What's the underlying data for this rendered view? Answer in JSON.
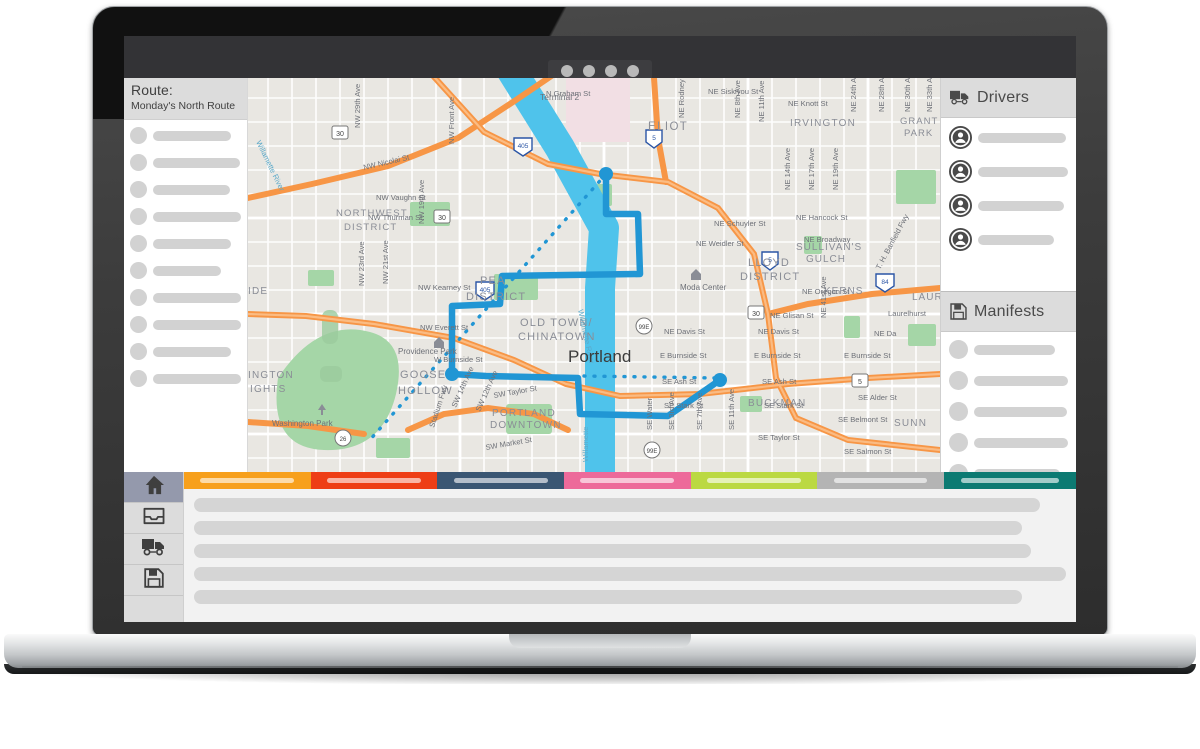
{
  "device": {
    "type": "laptop-mockup",
    "topbar": {
      "dots": 4
    }
  },
  "route_panel": {
    "title": "Route:",
    "subtitle": "Monday's North Route",
    "items": [
      {
        "bar_width_pct": 70
      },
      {
        "bar_width_pct": 78
      },
      {
        "bar_width_pct": 69
      },
      {
        "bar_width_pct": 85
      },
      {
        "bar_width_pct": 70
      },
      {
        "bar_width_pct": 61
      },
      {
        "bar_width_pct": 79
      },
      {
        "bar_width_pct": 86
      },
      {
        "bar_width_pct": 70
      },
      {
        "bar_width_pct": 83
      }
    ]
  },
  "drivers_panel": {
    "title": "Drivers",
    "icon": "truck-icon",
    "items": [
      {
        "bar_width_pct": 74
      },
      {
        "bar_width_pct": 79
      },
      {
        "bar_width_pct": 72
      },
      {
        "bar_width_pct": 64
      }
    ]
  },
  "manifests_panel": {
    "title": "Manifests",
    "icon": "floppy-disk-icon",
    "items": [
      {
        "bar_width_pct": 68
      },
      {
        "bar_width_pct": 86
      },
      {
        "bar_width_pct": 78
      },
      {
        "bar_width_pct": 84
      },
      {
        "bar_width_pct": 72
      }
    ]
  },
  "icon_rail": {
    "buttons": [
      {
        "icon": "home-icon",
        "name": "home",
        "active": true
      },
      {
        "icon": "inbox-tray-icon",
        "name": "inbox",
        "active": false
      },
      {
        "icon": "truck-icon",
        "name": "deliveries",
        "active": false
      },
      {
        "icon": "floppy-disk-icon",
        "name": "save",
        "active": false
      }
    ]
  },
  "tabbar": {
    "tabs": [
      {
        "color": "#F7A01C",
        "width_pct": 14.2
      },
      {
        "color": "#EE3E16",
        "width_pct": 14.2
      },
      {
        "color": "#3A5673",
        "width_pct": 14.2
      },
      {
        "color": "#ED6A9A",
        "width_pct": 14.2
      },
      {
        "color": "#BBD942",
        "width_pct": 14.2
      },
      {
        "color": "#B4B4B4",
        "width_pct": 14.2
      },
      {
        "color": "#0C7A72",
        "width_pct": 14.8
      }
    ]
  },
  "content": {
    "rows": [
      {
        "width_pct": 97
      },
      {
        "width_pct": 95
      },
      {
        "width_pct": 96
      },
      {
        "width_pct": 100
      },
      {
        "width_pct": 95
      }
    ]
  },
  "map": {
    "city_label": "Portland",
    "water_color": "#4FC3EB",
    "route_color": "#2196D4",
    "highway_color": "#F79646",
    "park_color": "#A5D6A7",
    "land_color": "#E9E7E2",
    "neighborhoods": [
      "Terminal 2",
      "ELIOT",
      "IRVINGTON",
      "GRANT PARK",
      "NORTHWEST DISTRICT",
      "LLOYD DISTRICT",
      "SULLIVAN'S GULCH",
      "KERNS",
      "LAURE",
      "PEARL DISTRICT",
      "OLD TOWN/ CHINATOWN",
      "GOOSE HOLLOW",
      "PORTLAND DOWNTOWN",
      "BUCKMAN",
      "SUNN",
      "INGTON IGHTS",
      "IDE"
    ],
    "streets": [
      "NW 29th Ave",
      "NW Nicolai St",
      "NW Vaughn St",
      "NW Thurman St",
      "NW Front Ave",
      "NW 19th Ave",
      "NW 23rd Ave",
      "NW 21st Ave",
      "NW Kearney St",
      "NW Everett St",
      "W Burnside St",
      "SW 14th Ave",
      "SW 12th Ave",
      "SW Taylor St",
      "SW Market St",
      "Stadium Fwy",
      "N Graham St",
      "NE Rodney Ave",
      "NE 8th Ave",
      "NE 11th Ave",
      "NE 14th Ave",
      "NE 17th Ave",
      "NE 19th Ave",
      "NE 24th Ave",
      "NE 28th Ave",
      "NE 30th Ave",
      "NE 33th Ave",
      "NE Siskiyou St",
      "NE Knott St",
      "NE Schuyler St",
      "NE Weidler St",
      "NE Broadway",
      "NE Hancock St",
      "NE Oregon St",
      "NE Glisan St",
      "NE Davis St",
      "E Burnside St",
      "SE Ash St",
      "SE Stark St",
      "SE Belmont St",
      "SE Taylor St",
      "SE Salmon St",
      "SE Alder St",
      "SE Water",
      "SE 3rd Ave",
      "SE 7th Ave",
      "SE 11th Ave",
      "NE 41st Ave",
      "Willamette River",
      "T. H. Banfield Fwy"
    ],
    "pois": [
      "Moda Center",
      "Providence Park",
      "Washington Park",
      "Laurelhurst"
    ],
    "shields": [
      "30",
      "405",
      "5",
      "84",
      "26",
      "99E"
    ]
  }
}
